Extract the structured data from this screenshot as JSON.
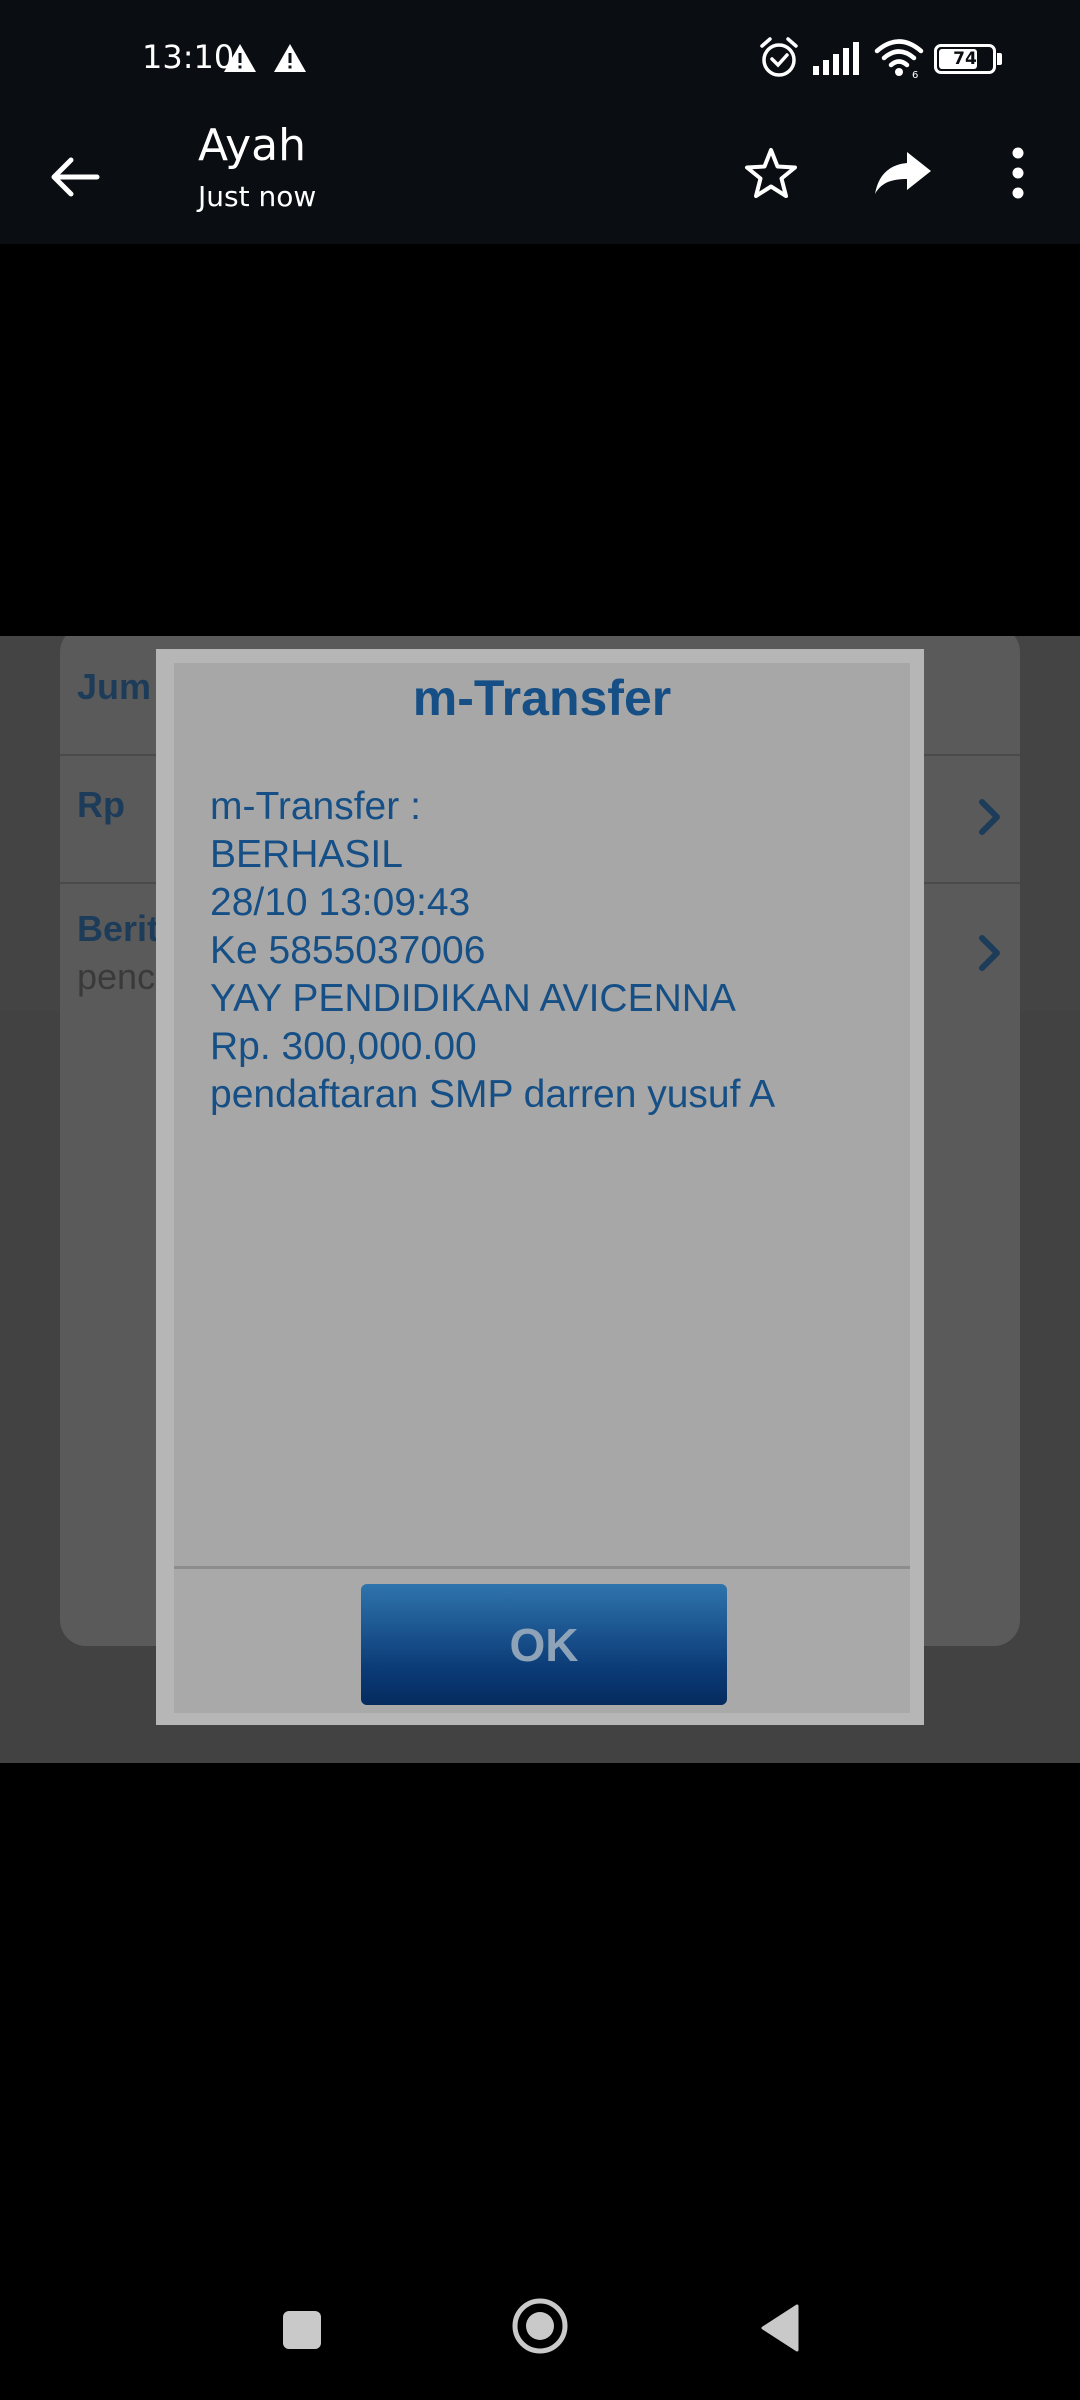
{
  "status_bar": {
    "time": "13:10",
    "battery": "74",
    "battery_level": 0.74,
    "icons": [
      "warning-icon",
      "warning-icon",
      "alarm-icon",
      "signal-icon",
      "wifi-icon",
      "battery-icon"
    ]
  },
  "header": {
    "title": "Ayah",
    "subtitle": "Just now",
    "icons": [
      "back-arrow-icon",
      "star-icon",
      "share-icon",
      "more-vert-icon"
    ]
  },
  "background": {
    "rows": [
      {
        "label": "Jum",
        "sub": ""
      },
      {
        "label": "Rp",
        "sub": ""
      },
      {
        "label": "Berit",
        "sub": "penc"
      }
    ]
  },
  "dialog": {
    "title": "m-Transfer",
    "lines": [
      "m-Transfer :",
      "BERHASIL",
      "28/10 13:09:43",
      "Ke 5855037006",
      "YAY PENDIDIKAN AVICENNA",
      "Rp. 300,000.00",
      "pendaftaran SMP darren yusuf A"
    ],
    "ok_label": "OK"
  },
  "nav_bar": {
    "icons": [
      "recents-square-icon",
      "home-circle-icon",
      "back-triangle-icon"
    ]
  },
  "colors": {
    "bar_background": "#0a0d11",
    "dialog_text": "#154f86",
    "ok_button": "#0b3b77"
  }
}
